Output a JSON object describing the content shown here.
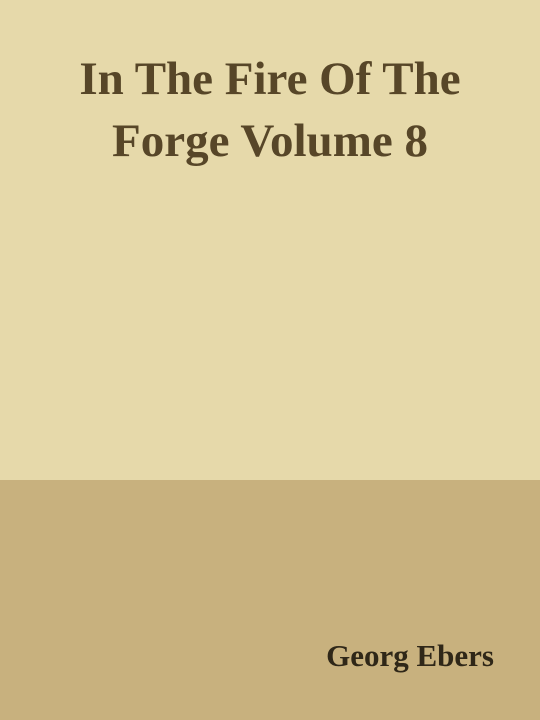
{
  "cover": {
    "title_lines": [
      "In The Fire Of The",
      "Forge Volume 8"
    ],
    "author": "Georg Ebers"
  },
  "colors": {
    "top_panel": "#e6d9aa",
    "bottom_panel": "#c8b17e",
    "title_text": "#574628",
    "author_text": "#2f2718"
  }
}
